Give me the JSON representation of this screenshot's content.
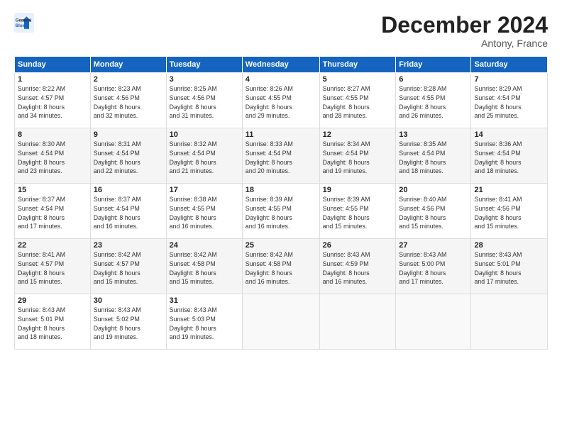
{
  "header": {
    "logo_line1": "General",
    "logo_line2": "Blue",
    "month": "December 2024",
    "location": "Antony, France"
  },
  "weekdays": [
    "Sunday",
    "Monday",
    "Tuesday",
    "Wednesday",
    "Thursday",
    "Friday",
    "Saturday"
  ],
  "weeks": [
    [
      {
        "day": "1",
        "info": "Sunrise: 8:22 AM\nSunset: 4:57 PM\nDaylight: 8 hours\nand 34 minutes."
      },
      {
        "day": "2",
        "info": "Sunrise: 8:23 AM\nSunset: 4:56 PM\nDaylight: 8 hours\nand 32 minutes."
      },
      {
        "day": "3",
        "info": "Sunrise: 8:25 AM\nSunset: 4:56 PM\nDaylight: 8 hours\nand 31 minutes."
      },
      {
        "day": "4",
        "info": "Sunrise: 8:26 AM\nSunset: 4:55 PM\nDaylight: 8 hours\nand 29 minutes."
      },
      {
        "day": "5",
        "info": "Sunrise: 8:27 AM\nSunset: 4:55 PM\nDaylight: 8 hours\nand 28 minutes."
      },
      {
        "day": "6",
        "info": "Sunrise: 8:28 AM\nSunset: 4:55 PM\nDaylight: 8 hours\nand 26 minutes."
      },
      {
        "day": "7",
        "info": "Sunrise: 8:29 AM\nSunset: 4:54 PM\nDaylight: 8 hours\nand 25 minutes."
      }
    ],
    [
      {
        "day": "8",
        "info": "Sunrise: 8:30 AM\nSunset: 4:54 PM\nDaylight: 8 hours\nand 23 minutes."
      },
      {
        "day": "9",
        "info": "Sunrise: 8:31 AM\nSunset: 4:54 PM\nDaylight: 8 hours\nand 22 minutes."
      },
      {
        "day": "10",
        "info": "Sunrise: 8:32 AM\nSunset: 4:54 PM\nDaylight: 8 hours\nand 21 minutes."
      },
      {
        "day": "11",
        "info": "Sunrise: 8:33 AM\nSunset: 4:54 PM\nDaylight: 8 hours\nand 20 minutes."
      },
      {
        "day": "12",
        "info": "Sunrise: 8:34 AM\nSunset: 4:54 PM\nDaylight: 8 hours\nand 19 minutes."
      },
      {
        "day": "13",
        "info": "Sunrise: 8:35 AM\nSunset: 4:54 PM\nDaylight: 8 hours\nand 18 minutes."
      },
      {
        "day": "14",
        "info": "Sunrise: 8:36 AM\nSunset: 4:54 PM\nDaylight: 8 hours\nand 18 minutes."
      }
    ],
    [
      {
        "day": "15",
        "info": "Sunrise: 8:37 AM\nSunset: 4:54 PM\nDaylight: 8 hours\nand 17 minutes."
      },
      {
        "day": "16",
        "info": "Sunrise: 8:37 AM\nSunset: 4:54 PM\nDaylight: 8 hours\nand 16 minutes."
      },
      {
        "day": "17",
        "info": "Sunrise: 8:38 AM\nSunset: 4:55 PM\nDaylight: 8 hours\nand 16 minutes."
      },
      {
        "day": "18",
        "info": "Sunrise: 8:39 AM\nSunset: 4:55 PM\nDaylight: 8 hours\nand 16 minutes."
      },
      {
        "day": "19",
        "info": "Sunrise: 8:39 AM\nSunset: 4:55 PM\nDaylight: 8 hours\nand 15 minutes."
      },
      {
        "day": "20",
        "info": "Sunrise: 8:40 AM\nSunset: 4:56 PM\nDaylight: 8 hours\nand 15 minutes."
      },
      {
        "day": "21",
        "info": "Sunrise: 8:41 AM\nSunset: 4:56 PM\nDaylight: 8 hours\nand 15 minutes."
      }
    ],
    [
      {
        "day": "22",
        "info": "Sunrise: 8:41 AM\nSunset: 4:57 PM\nDaylight: 8 hours\nand 15 minutes."
      },
      {
        "day": "23",
        "info": "Sunrise: 8:42 AM\nSunset: 4:57 PM\nDaylight: 8 hours\nand 15 minutes."
      },
      {
        "day": "24",
        "info": "Sunrise: 8:42 AM\nSunset: 4:58 PM\nDaylight: 8 hours\nand 15 minutes."
      },
      {
        "day": "25",
        "info": "Sunrise: 8:42 AM\nSunset: 4:58 PM\nDaylight: 8 hours\nand 16 minutes."
      },
      {
        "day": "26",
        "info": "Sunrise: 8:43 AM\nSunset: 4:59 PM\nDaylight: 8 hours\nand 16 minutes."
      },
      {
        "day": "27",
        "info": "Sunrise: 8:43 AM\nSunset: 5:00 PM\nDaylight: 8 hours\nand 17 minutes."
      },
      {
        "day": "28",
        "info": "Sunrise: 8:43 AM\nSunset: 5:01 PM\nDaylight: 8 hours\nand 17 minutes."
      }
    ],
    [
      {
        "day": "29",
        "info": "Sunrise: 8:43 AM\nSunset: 5:01 PM\nDaylight: 8 hours\nand 18 minutes."
      },
      {
        "day": "30",
        "info": "Sunrise: 8:43 AM\nSunset: 5:02 PM\nDaylight: 8 hours\nand 19 minutes."
      },
      {
        "day": "31",
        "info": "Sunrise: 8:43 AM\nSunset: 5:03 PM\nDaylight: 8 hours\nand 19 minutes."
      },
      null,
      null,
      null,
      null
    ]
  ]
}
